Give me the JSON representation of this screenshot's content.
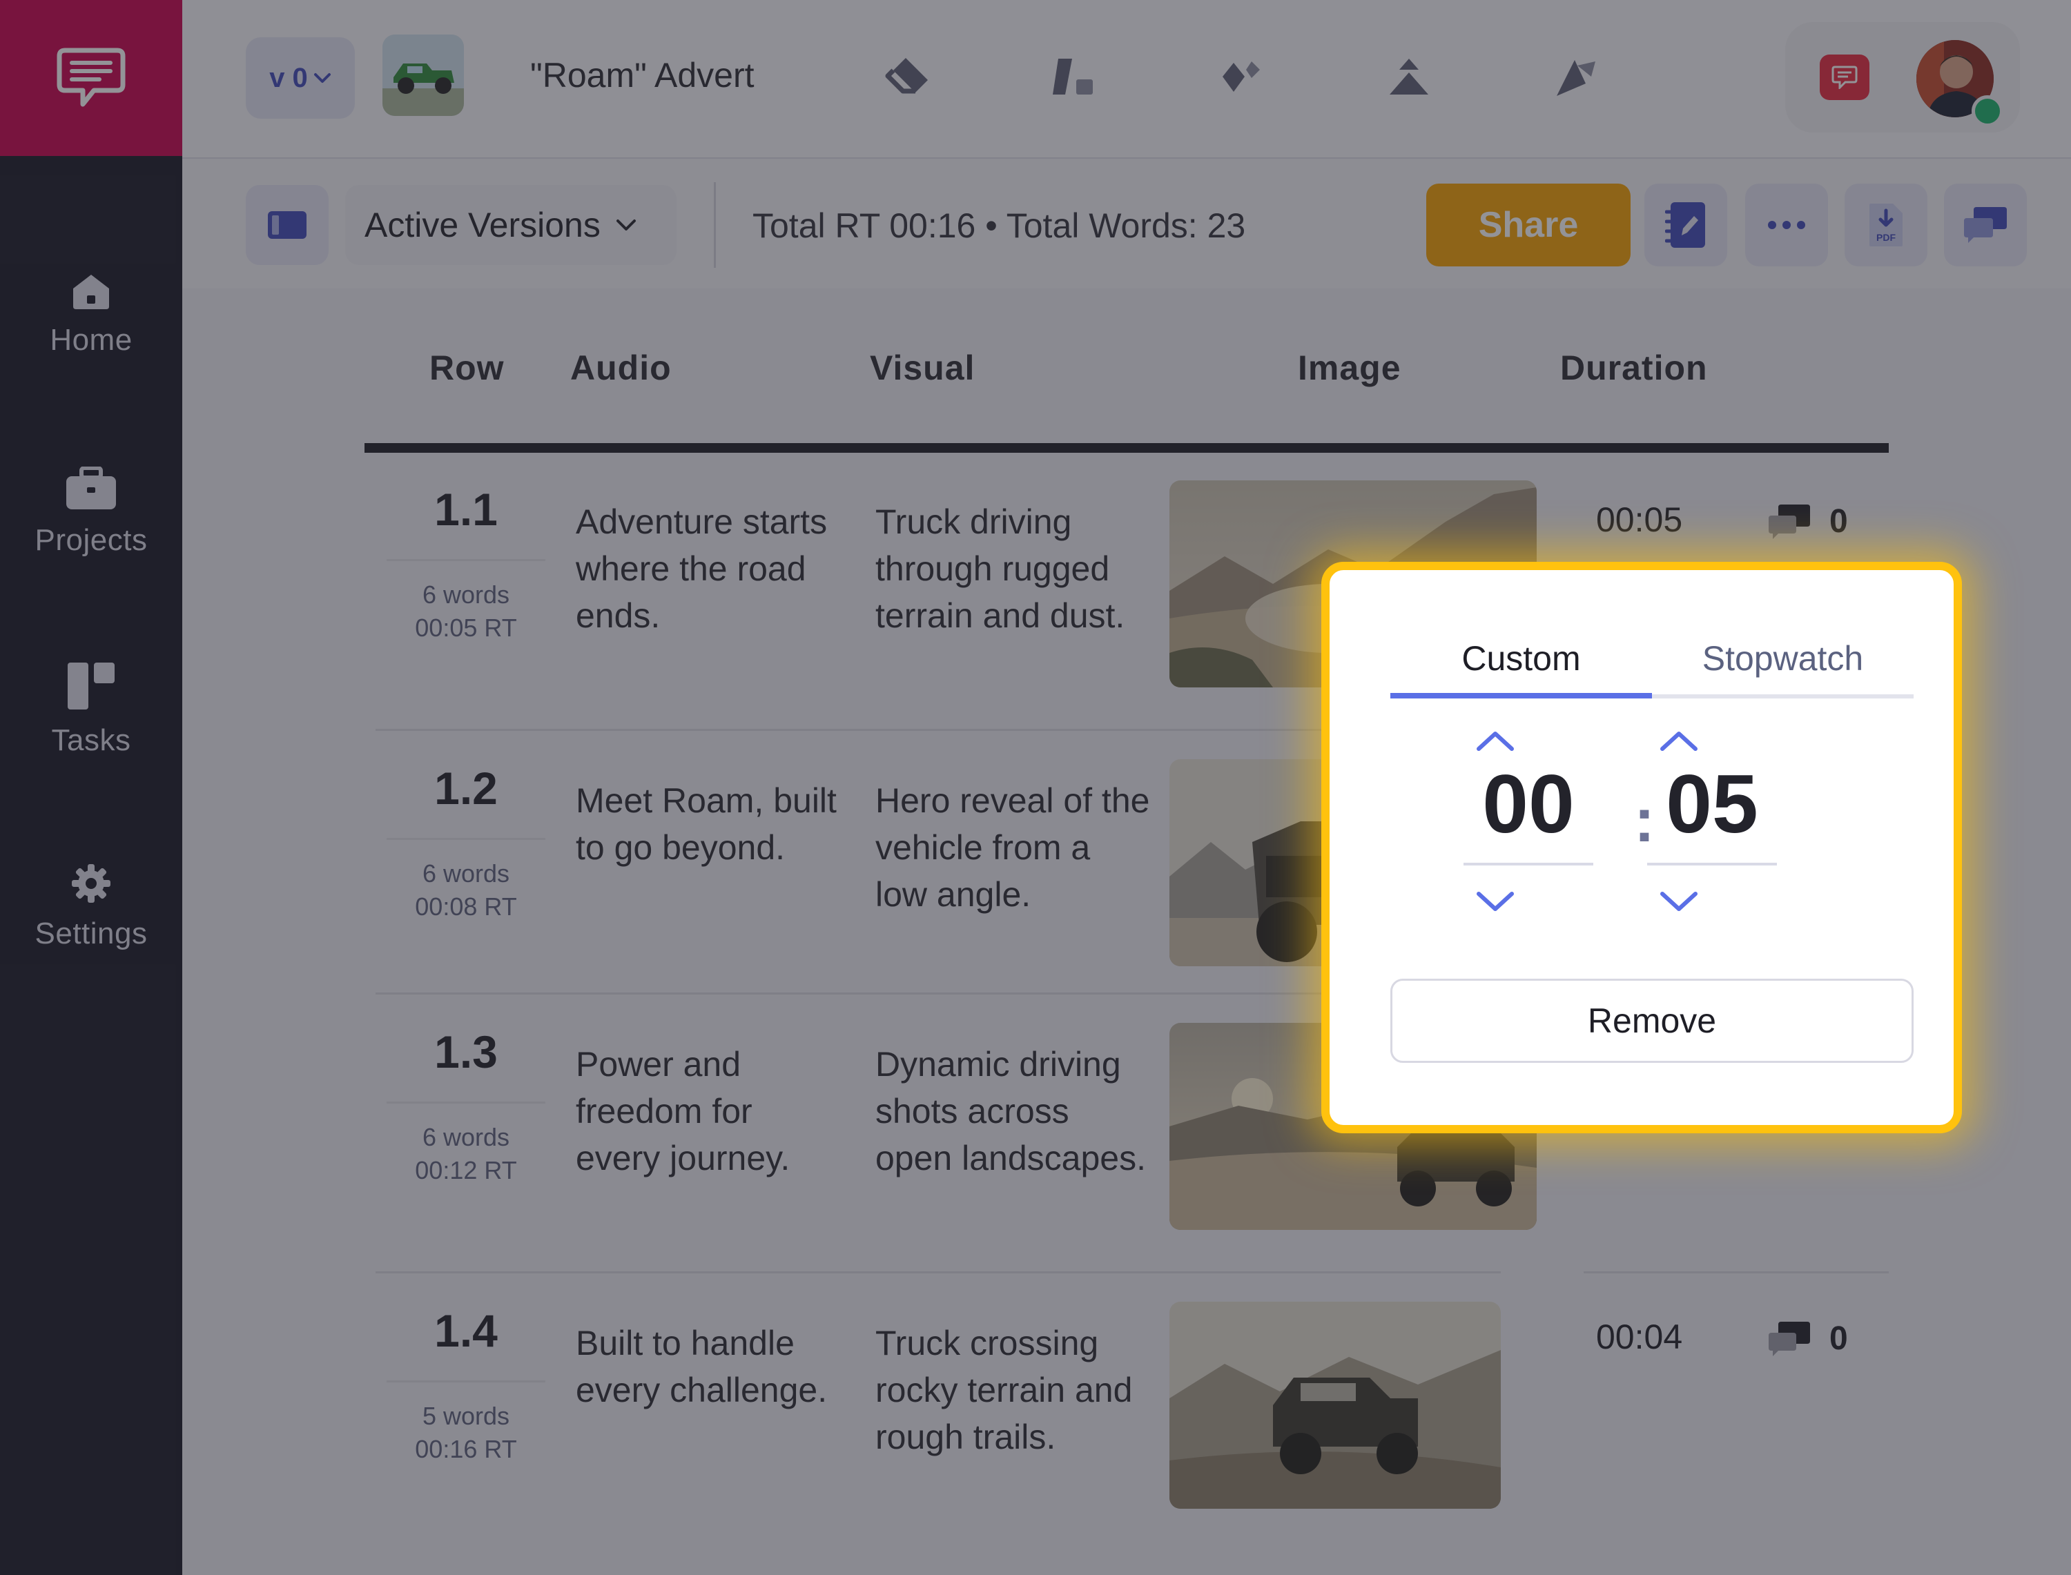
{
  "app": {
    "version": "v 0",
    "project_title": "\"Roam\" Advert"
  },
  "sidebar": {
    "items": [
      {
        "label": "Home",
        "icon": "home-icon"
      },
      {
        "label": "Projects",
        "icon": "briefcase-icon"
      },
      {
        "label": "Tasks",
        "icon": "kanban-icon"
      },
      {
        "label": "Settings",
        "icon": "gear-icon"
      }
    ]
  },
  "toolbar": {
    "versions_label": "Active Versions",
    "totals": "Total RT 00:16 • Total Words: 23",
    "share_label": "Share",
    "pdf_label": "PDF"
  },
  "table": {
    "headers": [
      "Row",
      "Audio",
      "Visual",
      "Image",
      "Duration"
    ],
    "rows": [
      {
        "num": "1.1",
        "words": "6 words",
        "rt": "00:05 RT",
        "audio": "Adventure starts where the road ends.",
        "visual": "Truck driving through rugged terrain and dust.",
        "duration": "00:05",
        "comments": "0"
      },
      {
        "num": "1.2",
        "words": "6 words",
        "rt": "00:08 RT",
        "audio": "Meet Roam, built to go beyond.",
        "visual": "Hero reveal of the vehicle from a low angle.",
        "duration": "",
        "comments": ""
      },
      {
        "num": "1.3",
        "words": "6 words",
        "rt": "00:12 RT",
        "audio": "Power and freedom for every journey.",
        "visual": "Dynamic driving shots across open landscapes.",
        "duration": "",
        "comments": ""
      },
      {
        "num": "1.4",
        "words": "5 words",
        "rt": "00:16 RT",
        "audio": "Built to handle every challenge.",
        "visual": "Truck crossing rocky terrain and rough trails.",
        "duration": "00:04",
        "comments": "0"
      }
    ]
  },
  "duration_popup": {
    "tabs": [
      "Custom",
      "Stopwatch"
    ],
    "active_tab": "Custom",
    "minutes": "00",
    "seconds": "05",
    "separator": ":",
    "remove_label": "Remove"
  },
  "colors": {
    "brand": "#c8004c",
    "accent": "#5a6fe6",
    "share": "#f4a100",
    "highlight": "#ffc20e"
  }
}
